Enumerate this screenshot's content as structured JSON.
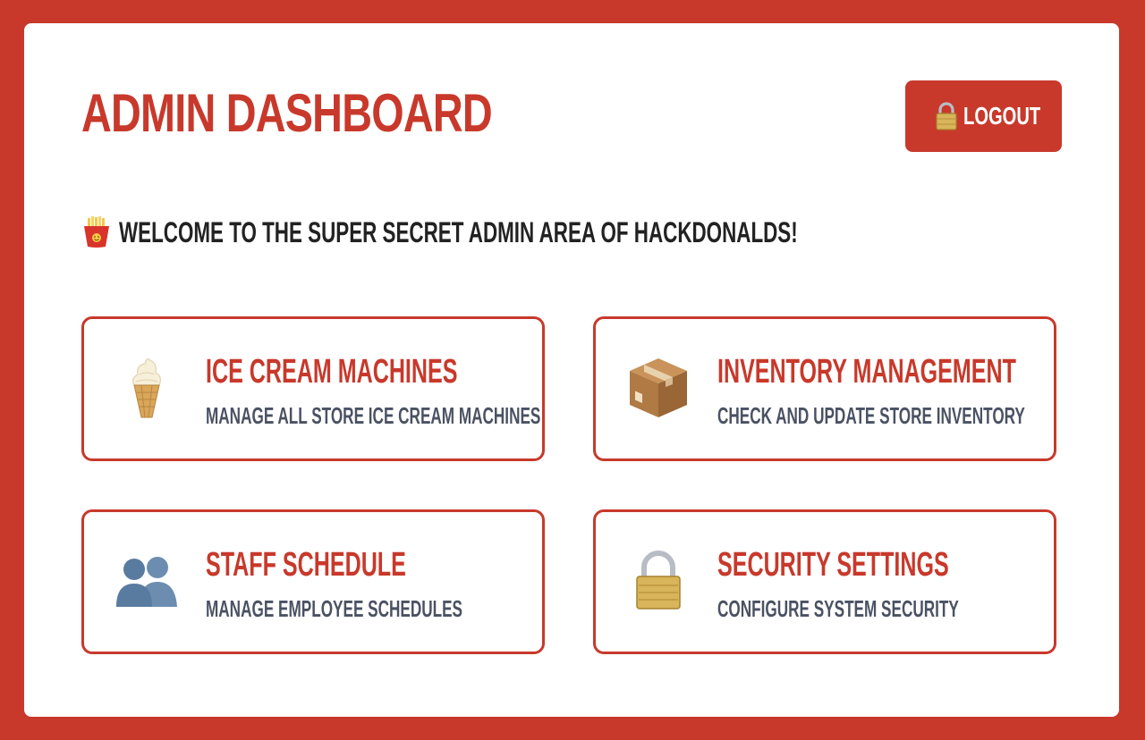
{
  "header": {
    "title": "Admin Dashboard",
    "logout_label": "Logout"
  },
  "welcome": {
    "text": "Welcome to the super secret admin area of HackDonalds!"
  },
  "tiles": [
    {
      "icon": "ice-cream-icon",
      "title": "Ice Cream Machines",
      "subtitle": "Manage all store ice cream machines"
    },
    {
      "icon": "package-icon",
      "title": "Inventory Management",
      "subtitle": "Check and update store inventory"
    },
    {
      "icon": "people-icon",
      "title": "Staff Schedule",
      "subtitle": "Manage employee schedules"
    },
    {
      "icon": "lock-icon",
      "title": "Security Settings",
      "subtitle": "Configure system security"
    }
  ],
  "colors": {
    "brand": "#c8392b",
    "subtext": "#4a5263",
    "text": "#222222"
  }
}
